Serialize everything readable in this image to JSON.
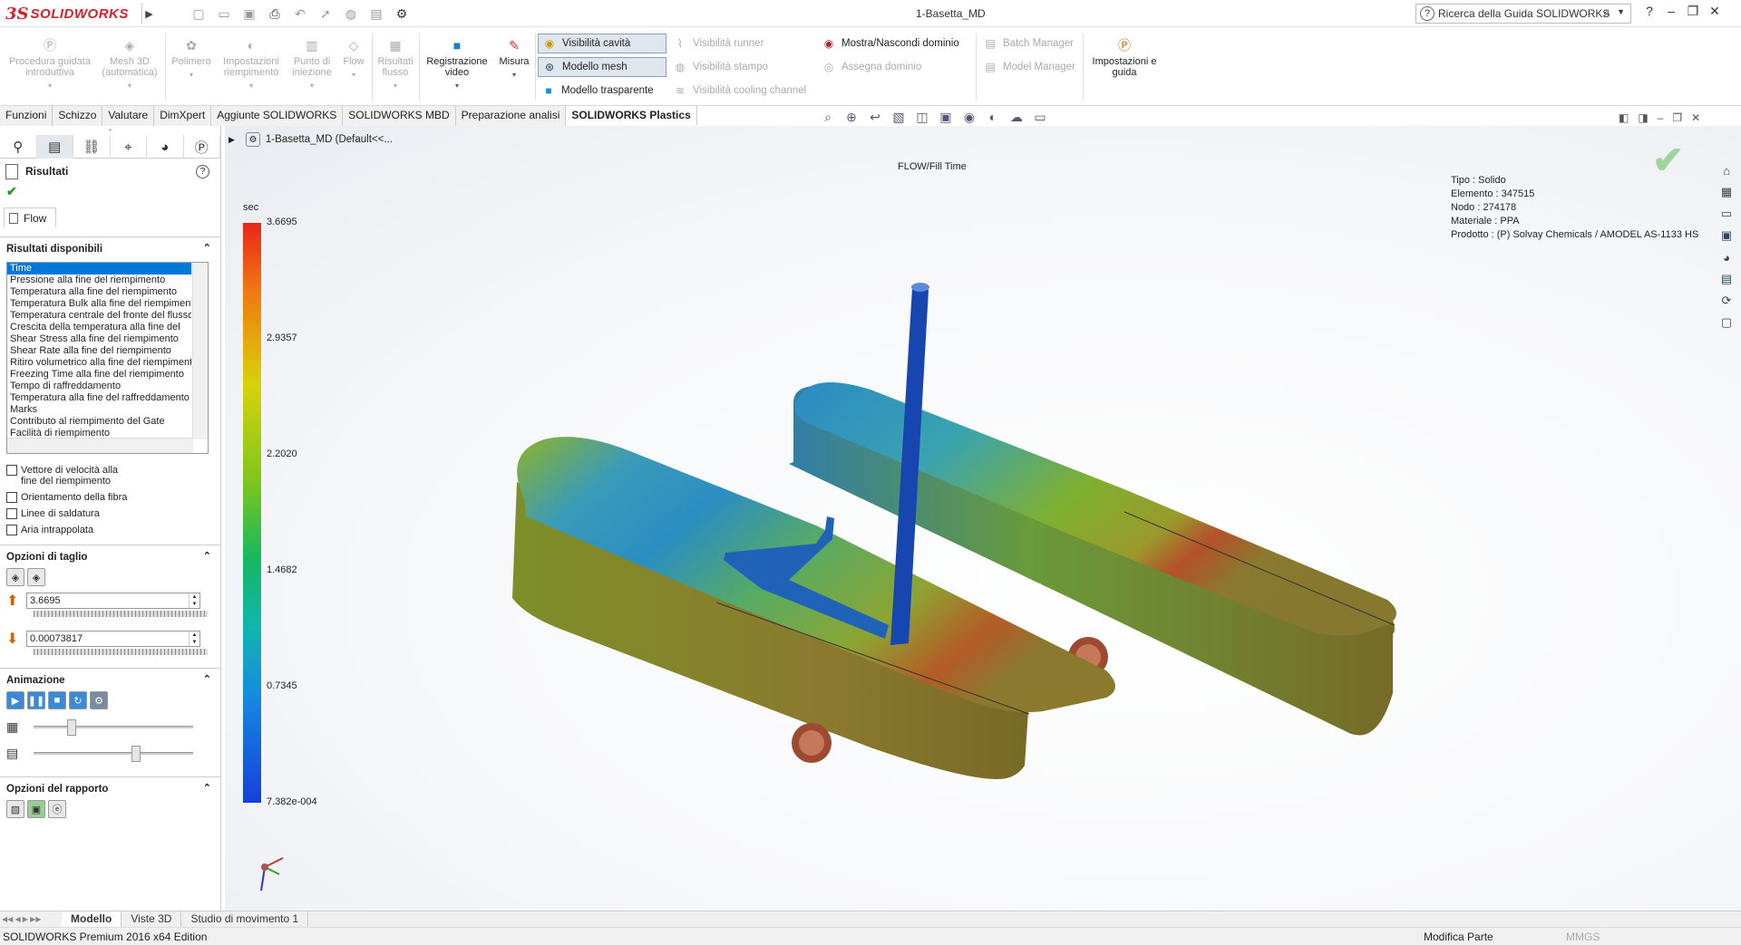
{
  "app": {
    "logo_ds": "3S",
    "logo_name": "SOLIDWORKS",
    "doc_title": "1-Basetta_MD"
  },
  "search": {
    "placeholder": "Ricerca della Guida SOLIDWORKS"
  },
  "ribbon": {
    "procedura": "Procedura guidata introduttiva",
    "mesh3d": "Mesh 3D (automatica)",
    "polimero": "Polimero",
    "impostazioni_riemp": "Impostazioni riempimento",
    "punto_iniezione": "Punto di iniezione",
    "flow": "Flow",
    "risultati_flusso": "Risultati flusso",
    "registrazione": "Registrazione video",
    "misura": "Misura",
    "visibilita_cavita": "Visibilità cavità",
    "modello_mesh": "Modello mesh",
    "modello_trasparente": "Modello trasparente",
    "visibilita_runner": "Visibilità runner",
    "visibilita_stampo": "Visibilità stampo",
    "visibilita_cooling": "Visibilità cooling channel",
    "mostra_dominio": "Mostra/Nascondi dominio",
    "assegna_dominio": "Assegna dominio",
    "batch_manager": "Batch Manager",
    "model_manager": "Model Manager",
    "impostazioni_guida": "Impostazioni e guida"
  },
  "tabs": [
    "Funzioni",
    "Schizzo",
    "Valutare",
    "DimXpert",
    "Aggiunte SOLIDWORKS",
    "SOLIDWORKS MBD",
    "Preparazione analisi",
    "SOLIDWORKS Plastics"
  ],
  "panel": {
    "title": "Risultati",
    "flow_tab": "Flow",
    "risultati_header": "Risultati disponibili",
    "results": [
      "Time",
      "Pressione alla fine del riempimento",
      "Temperatura alla fine del riempimento",
      "Temperatura Bulk alla fine del riempimento",
      "Temperatura centrale del fronte del flusso",
      "Crescita della temperatura alla fine del",
      "Shear Stress alla fine del riempimento",
      "Shear Rate alla fine del riempimento",
      "Ritiro volumetrico alla fine del riempimento",
      "Freezing Time alla fine del riempimento",
      "Tempo di raffreddamento",
      "Temperatura alla fine del raffreddamento",
      "Marks",
      "Contributo al riempimento del Gate",
      "Facilità di riempimento"
    ],
    "checkboxes": [
      "Vettore di velocità alla fine del riempimento",
      "Orientamento della fibra",
      "Linee di saldatura",
      "Aria intrappolata"
    ],
    "taglio_header": "Opzioni di taglio",
    "max_value": "3.6695",
    "min_value": "0.00073817",
    "animazione_header": "Animazione",
    "slider1_level": 0.22,
    "slider2_level": 0.65,
    "rapporto_header": "Opzioni del rapporto"
  },
  "viewport": {
    "breadcrumb": "1-Basetta_MD  (Default<<...",
    "plot_title": "FLOW/Fill Time",
    "info": [
      "Tipo : Solido",
      "Elemento : 347515",
      "Nodo : 274178",
      "Materiale : PPA",
      "Prodotto :   (P)  Solvay Chemicals / AMODEL AS-1133 HS"
    ],
    "unit": "sec",
    "scale_labels": [
      "3.6695",
      "2.9357",
      "2.2020",
      "1.4682",
      "0.7345",
      "7.382e-004"
    ]
  },
  "bottom_tabs": [
    "Modello",
    "Viste 3D",
    "Studio di movimento 1"
  ],
  "status": {
    "left": "SOLIDWORKS Premium 2016 x64 Edition",
    "mode": "Modifica Parte",
    "units": "MMGS"
  },
  "colors": {
    "brand": "#d8202a",
    "selection": "#0078d7"
  }
}
